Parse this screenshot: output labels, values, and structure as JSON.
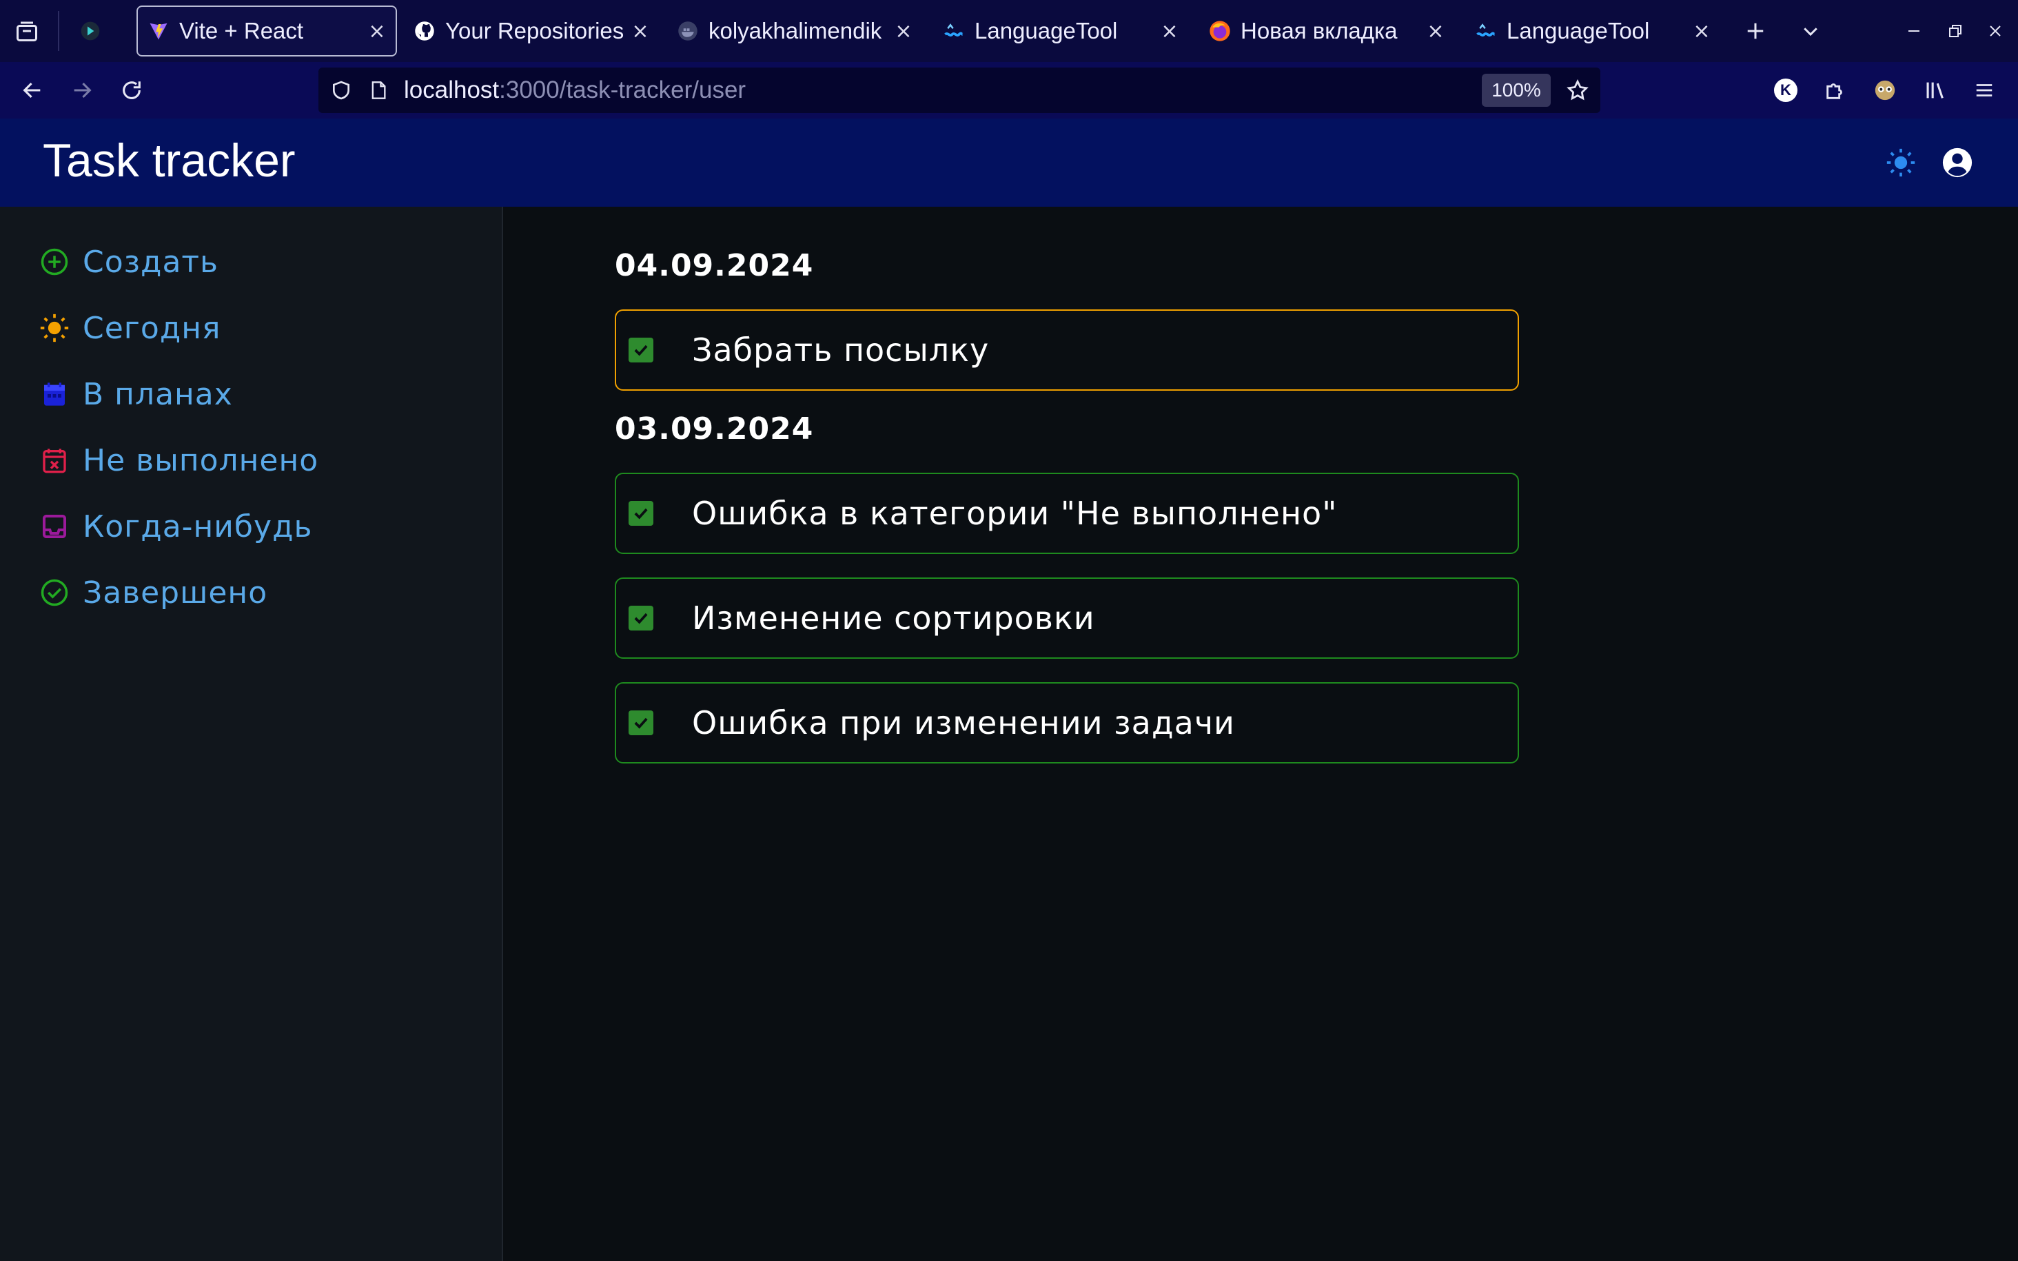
{
  "browser": {
    "tabs": [
      {
        "title": "Vite + React",
        "active": true,
        "icon": "vite-icon"
      },
      {
        "title": "Your Repositories",
        "active": false,
        "icon": "github-icon"
      },
      {
        "title": "kolyakhalimendik",
        "active": false,
        "icon": "docker-icon"
      },
      {
        "title": "LanguageTool",
        "active": false,
        "icon": "languagetool-icon"
      },
      {
        "title": "Новая вкладка",
        "active": false,
        "icon": "firefox-icon"
      },
      {
        "title": "LanguageTool",
        "active": false,
        "icon": "languagetool-icon"
      }
    ],
    "url": {
      "host": "localhost",
      "path": ":3000/task-tracker/user"
    },
    "zoom": "100%",
    "extension_badge": "K"
  },
  "app": {
    "title": "Task tracker",
    "accent": "#03115f"
  },
  "sidebar": {
    "items": [
      {
        "label": "Создать",
        "icon": "plus-circle-icon",
        "color": "#22aa22"
      },
      {
        "label": "Сегодня",
        "icon": "sun-icon",
        "color": "#f5a100"
      },
      {
        "label": "В планах",
        "icon": "calendar-icon",
        "color": "#1a22d8"
      },
      {
        "label": "Не выполнено",
        "icon": "calendar-x-icon",
        "color": "#e0204a"
      },
      {
        "label": "Когда-нибудь",
        "icon": "inbox-icon",
        "color": "#9b1a9b"
      },
      {
        "label": "Завершено",
        "icon": "check-circle-icon",
        "color": "#22aa22"
      }
    ]
  },
  "main": {
    "groups": [
      {
        "date": "04.09.2024",
        "tasks": [
          {
            "text": "Забрать посылку",
            "done": true,
            "status_color": "#f0a000"
          }
        ]
      },
      {
        "date": "03.09.2024",
        "tasks": [
          {
            "text": "Ошибка в категории \"Не выполнено\"",
            "done": true,
            "status_color": "#1e8a1e"
          },
          {
            "text": "Изменение сортировки",
            "done": true,
            "status_color": "#1e8a1e"
          },
          {
            "text": "Ошибка при изменении задачи",
            "done": true,
            "status_color": "#1e8a1e"
          }
        ]
      }
    ]
  }
}
